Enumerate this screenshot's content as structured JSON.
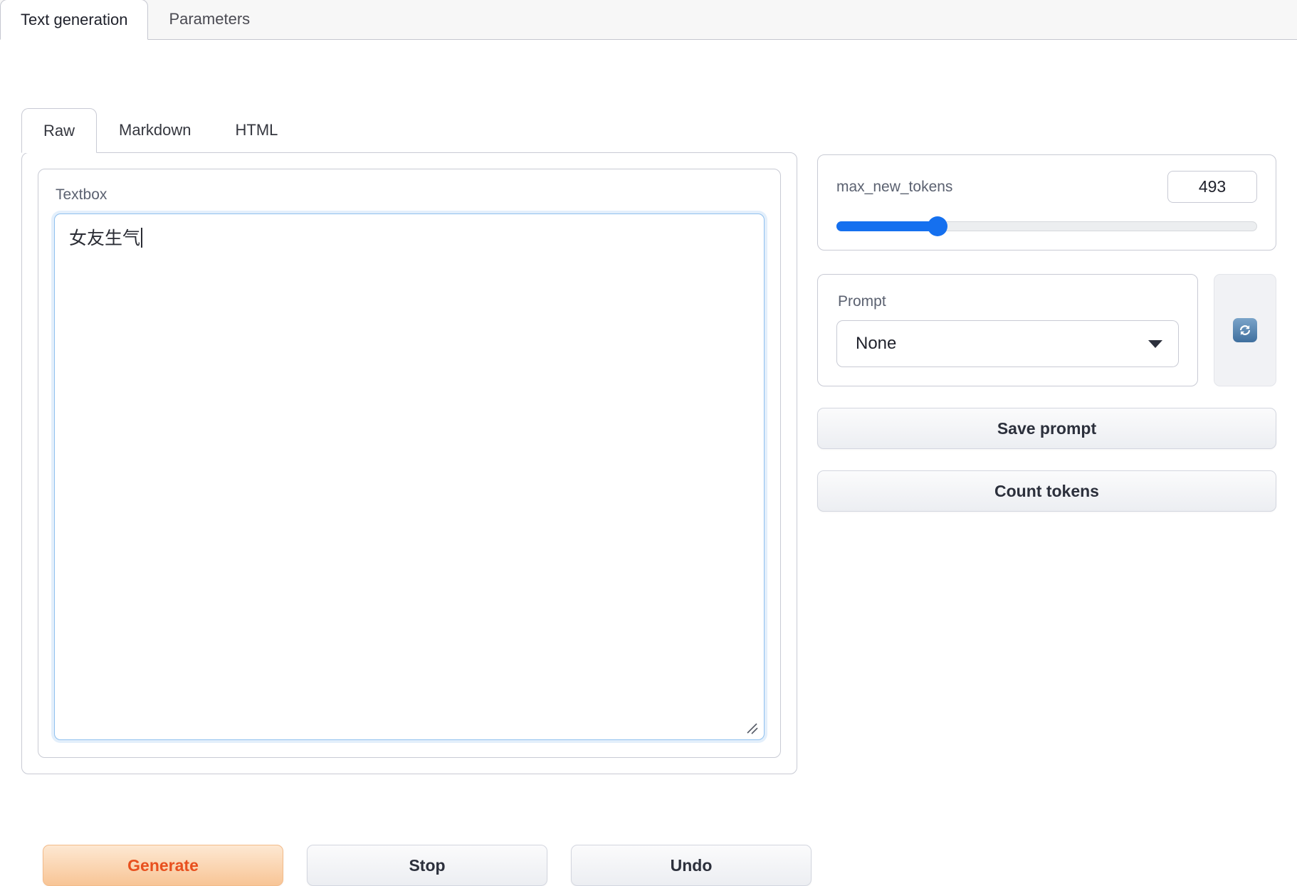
{
  "top_tabs": [
    {
      "label": "Text generation",
      "active": true
    },
    {
      "label": "Parameters",
      "active": false
    }
  ],
  "output_tabs": [
    {
      "label": "Raw",
      "active": true
    },
    {
      "label": "Markdown",
      "active": false
    },
    {
      "label": "HTML",
      "active": false
    }
  ],
  "textbox": {
    "label": "Textbox",
    "value": "女友生气",
    "placeholder": "",
    "resize_handle_icon": "resize-grip-icon"
  },
  "actions": {
    "generate_label": "Generate",
    "stop_label": "Stop",
    "undo_label": "Undo"
  },
  "max_new_tokens": {
    "label": "max_new_tokens",
    "value": "493",
    "fill_percent": "24%",
    "thumb_percent": "24%"
  },
  "prompt": {
    "label": "Prompt",
    "selected": "None",
    "caret_icon": "chevron-down-icon",
    "refresh_icon": "refresh-icon"
  },
  "right_buttons": {
    "save_prompt_label": "Save prompt",
    "count_tokens_label": "Count tokens"
  },
  "colors": {
    "accent_blue": "#1570ef",
    "generate_text": "#e8501e",
    "generate_bg_top": "#fde8d2",
    "generate_bg_bottom": "#f8c596",
    "border": "#c8cad4",
    "focus_border": "#8fc0ef",
    "label_gray": "#5b6170"
  }
}
